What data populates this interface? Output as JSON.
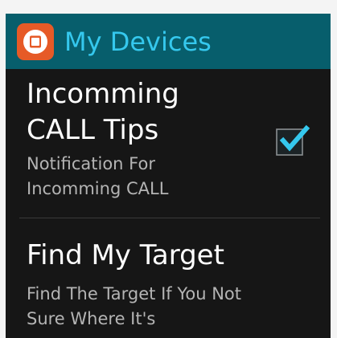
{
  "header": {
    "title": "My Devices",
    "icon": "watch-icon",
    "accent_color": "#35c8ee",
    "bar_color": "#075e6c",
    "icon_color": "#e65a27"
  },
  "settings": {
    "items": [
      {
        "title_line1": "Incomming",
        "title_line2": "CALL Tips",
        "summary_line1": "Notification For",
        "summary_line2": "Incomming CALL",
        "checked": true,
        "checkbox_icon": "checkmark-icon"
      },
      {
        "title": "Find My Target",
        "summary_line1": "Find The Target If You Not",
        "summary_line2": "Sure Where It's"
      }
    ]
  }
}
